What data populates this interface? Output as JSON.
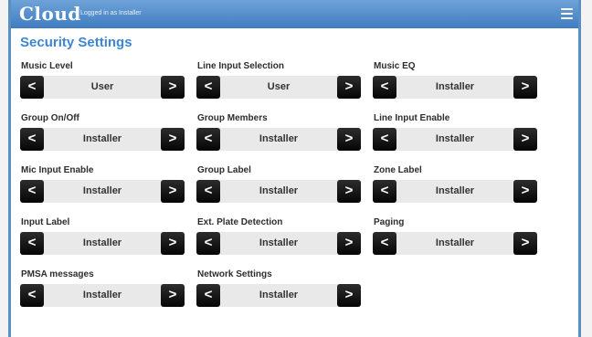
{
  "header": {
    "logo": "Cloud",
    "logged_in": "Logged in as Installer",
    "menu_icon": "hamburger-menu-icon"
  },
  "page": {
    "title": "Security Settings"
  },
  "controls": {
    "prev_symbol": "<",
    "next_symbol": ">"
  },
  "settings": [
    {
      "label": "Music Level",
      "value": "User"
    },
    {
      "label": "Line Input Selection",
      "value": "User"
    },
    {
      "label": "Music EQ",
      "value": "Installer"
    },
    {
      "label": "Group On/Off",
      "value": "Installer"
    },
    {
      "label": "Group Members",
      "value": "Installer"
    },
    {
      "label": "Line Input Enable",
      "value": "Installer"
    },
    {
      "label": "Mic Input Enable",
      "value": "Installer"
    },
    {
      "label": "Group Label",
      "value": "Installer"
    },
    {
      "label": "Zone Label",
      "value": "Installer"
    },
    {
      "label": "Input Label",
      "value": "Installer"
    },
    {
      "label": "Ext. Plate Detection",
      "value": "Installer"
    },
    {
      "label": "Paging",
      "value": "Installer"
    },
    {
      "label": "PMSA messages",
      "value": "Installer"
    },
    {
      "label": "Network Settings",
      "value": "Installer"
    }
  ]
}
